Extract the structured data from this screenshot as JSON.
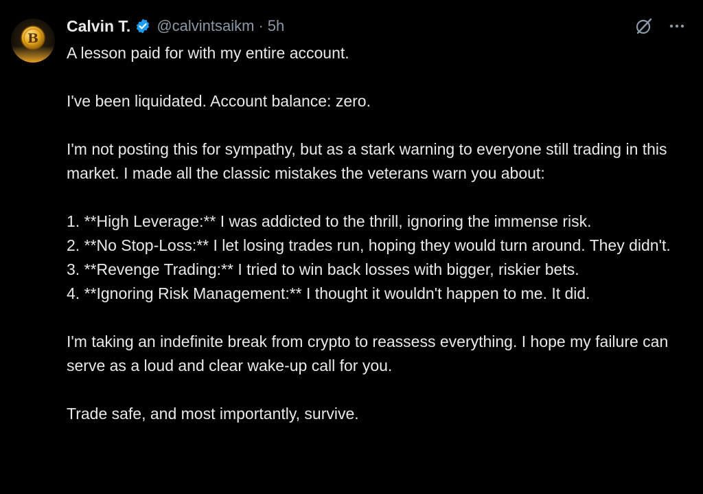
{
  "author": {
    "display_name": "Calvin T.",
    "handle": "@calvintsaikm",
    "separator": "·",
    "time": "5h",
    "avatar_letter": "B"
  },
  "colors": {
    "background": "#000000",
    "text": "#e7e9ea",
    "muted": "#8b98a5",
    "verified": "#1d9bf0",
    "coin": "#f2a900"
  },
  "icons": {
    "verified": "verified-badge-icon",
    "grok": "grok-icon",
    "more": "more-options-icon"
  },
  "tweet": {
    "line1": "A lesson paid for with my entire account.",
    "line2": "I've been liquidated. Account balance: zero.",
    "line3": "I'm not posting this for sympathy, but as a stark warning to everyone still trading in this market. I made all the classic mistakes the veterans warn you about:",
    "item1": "1.  **High Leverage:** I was addicted to the thrill, ignoring the immense risk.",
    "item2": "2.  **No Stop-Loss:** I let losing trades run, hoping they would turn around. They didn't.",
    "item3": "3.  **Revenge Trading:** I tried to win back losses with bigger, riskier bets.",
    "item4": "4.  **Ignoring Risk Management:** I thought it wouldn't happen to me. It did.",
    "line4": "I'm taking an indefinite break from crypto to reassess everything. I hope my failure can serve as a loud and clear wake-up call for you.",
    "line5": "Trade safe, and most importantly, survive."
  }
}
